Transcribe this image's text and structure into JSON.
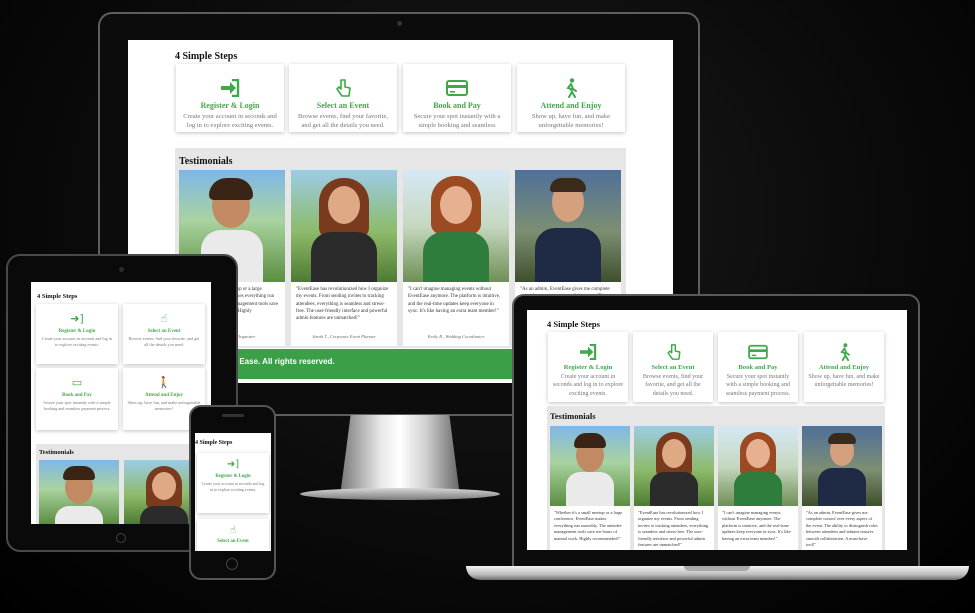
{
  "steps_title": "4 Simple Steps",
  "steps": [
    {
      "icon": "login-icon",
      "title": "Register & Login",
      "desc": "Create your account in seconds and log in to explore exciting events."
    },
    {
      "icon": "tap-icon",
      "title": "Select an Event",
      "desc": "Browse events, find your favorite, and get all the details you need."
    },
    {
      "icon": "card-icon",
      "title": "Book and Pay",
      "desc": "Secure your spot instantly with a simple booking and seamless payment process."
    },
    {
      "icon": "walk-icon",
      "title": "Attend and Enjoy",
      "desc": "Show up, have fun, and make unforgettable memories!"
    }
  ],
  "testimonials_title": "Testimonials",
  "testimonials": [
    {
      "quote": "\"Whether it's a small meetup or a large conference, EventEase makes everything run smoothly. The attendee management tools save me hours of manual work. Highly recommended!\"",
      "author": "Mark L., Event Organizer"
    },
    {
      "quote": "\"EventEase has revolutionized how I organize my events. From sending invites to tracking attendees, everything is seamless and stress-free. The user-friendly interface and powerful admin features are unmatched!\"",
      "author": "Sarah T., Corporate Event Planner"
    },
    {
      "quote": "\"I can't imagine managing events without EventEase anymore. The platform is intuitive, and the real-time updates keep everyone in sync. It's like having an extra team member!\"",
      "author": "Emily R., Wedding Coordinator"
    },
    {
      "quote": "\"As an admin, EventEase gives me complete control over every aspect of the event. The ability to distinguish roles between attendees and admins ensures smooth collaboration. A must-have tool!\"",
      "author": "James P., Community Manager"
    }
  ],
  "footer_text": "et Ease. All rights reserved.",
  "colors": {
    "accent": "#3fa84a",
    "footer": "#3b9f47",
    "testimonial_bg": "#e6e6e6",
    "backdrop": "#000000"
  }
}
